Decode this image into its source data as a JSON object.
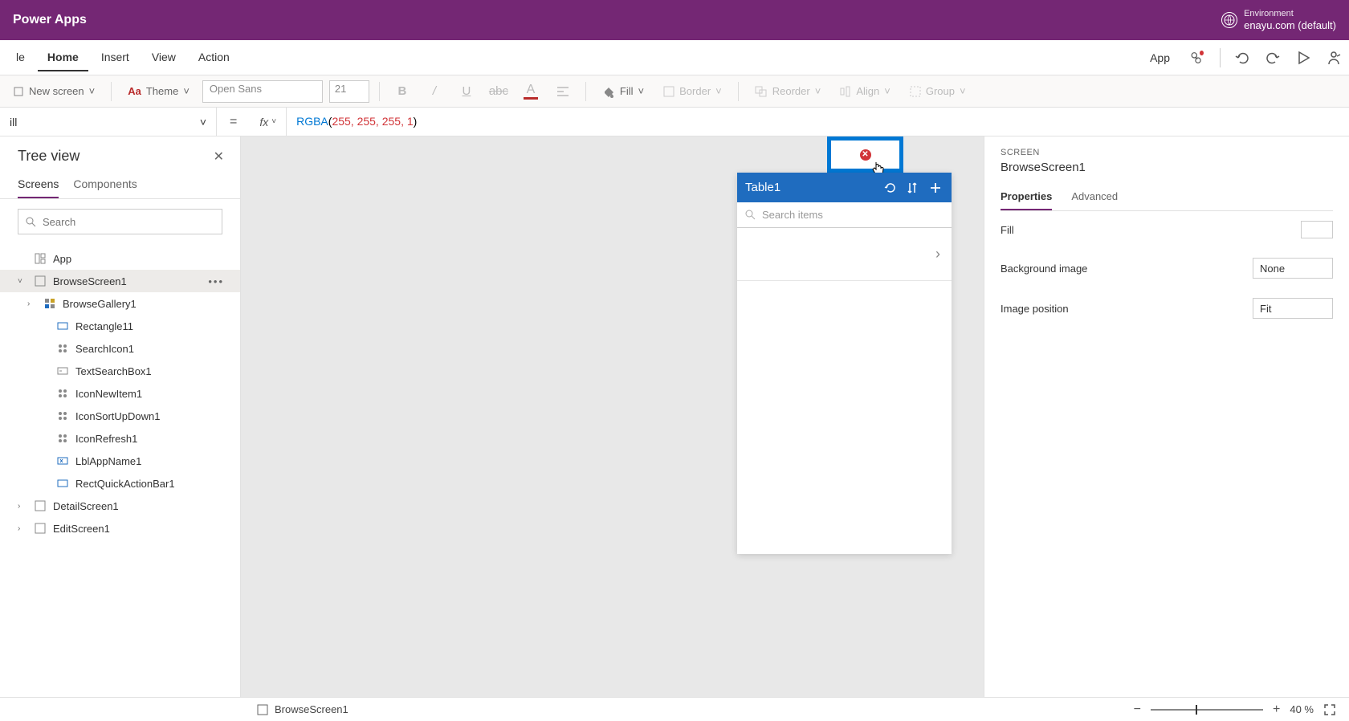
{
  "header": {
    "app_title": "Power Apps",
    "env_label": "Environment",
    "env_name": "enayu.com (default)"
  },
  "menu": {
    "items": [
      "le",
      "Home",
      "Insert",
      "View",
      "Action"
    ],
    "active": "Home",
    "app_label": "App"
  },
  "ribbon": {
    "new_screen": "New screen",
    "theme": "Theme",
    "font": "Open Sans",
    "size": "21",
    "fill": "Fill",
    "border": "Border",
    "reorder": "Reorder",
    "align": "Align",
    "group": "Group"
  },
  "formula": {
    "property": "ill",
    "fx": "fx",
    "func": "RGBA",
    "args": "255, 255, 255, 1"
  },
  "tree": {
    "title": "Tree view",
    "tabs": [
      "Screens",
      "Components"
    ],
    "active_tab": "Screens",
    "search_placeholder": "Search",
    "app_node": "App",
    "items": [
      {
        "name": "BrowseScreen1",
        "selected": true,
        "expandable": true,
        "expanded": true,
        "indent": 0,
        "icon": "screen",
        "more": true
      },
      {
        "name": "BrowseGallery1",
        "expandable": true,
        "indent": 1,
        "icon": "gallery"
      },
      {
        "name": "Rectangle11",
        "indent": 2,
        "icon": "rect"
      },
      {
        "name": "SearchIcon1",
        "indent": 2,
        "icon": "icon"
      },
      {
        "name": "TextSearchBox1",
        "indent": 2,
        "icon": "textbox"
      },
      {
        "name": "IconNewItem1",
        "indent": 2,
        "icon": "icon"
      },
      {
        "name": "IconSortUpDown1",
        "indent": 2,
        "icon": "icon"
      },
      {
        "name": "IconRefresh1",
        "indent": 2,
        "icon": "icon"
      },
      {
        "name": "LblAppName1",
        "indent": 2,
        "icon": "label"
      },
      {
        "name": "RectQuickActionBar1",
        "indent": 2,
        "icon": "rect"
      },
      {
        "name": "DetailScreen1",
        "expandable": true,
        "indent": 0,
        "icon": "screen"
      },
      {
        "name": "EditScreen1",
        "expandable": true,
        "indent": 0,
        "icon": "screen"
      }
    ]
  },
  "canvas": {
    "phone_title": "Table1",
    "search_placeholder": "Search items"
  },
  "properties": {
    "section_label": "SCREEN",
    "name": "BrowseScreen1",
    "tabs": [
      "Properties",
      "Advanced"
    ],
    "active_tab": "Properties",
    "rows": [
      {
        "label": "Fill",
        "type": "swatch"
      },
      {
        "label": "Background image",
        "value": "None"
      },
      {
        "label": "Image position",
        "value": "Fit"
      }
    ]
  },
  "status": {
    "screen": "BrowseScreen1",
    "zoom": "40 %"
  }
}
